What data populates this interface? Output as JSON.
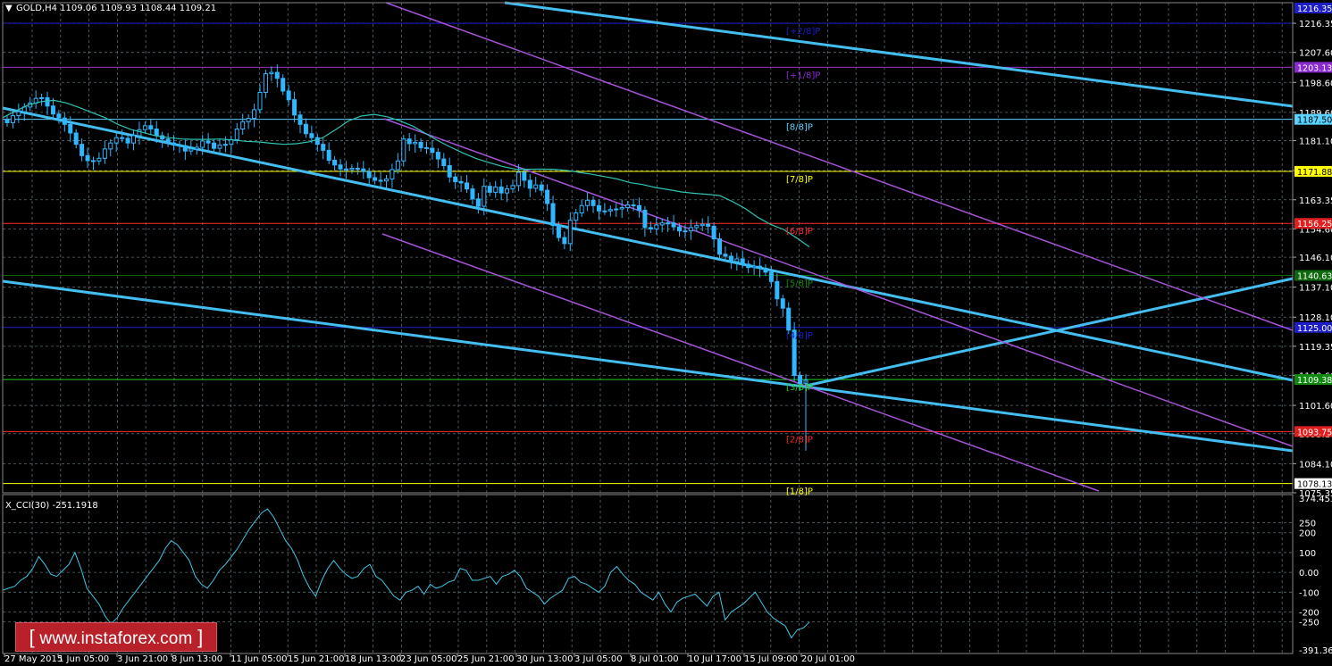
{
  "window": {
    "symbol_header": "GOLD,H4  1109.06 1109.93 1108.44 1109.21",
    "indicator_header": "X_CCI(30) -251.1918"
  },
  "colors": {
    "background": "#000000",
    "grid": "#5a6b72",
    "bull": "#2fb7ff",
    "bear": "#2fb7ff",
    "ma": "#2fc4b2",
    "channel_cyan": "#44bdf0",
    "channel_purple": "#a653d8",
    "cci_line": "#42c6e6",
    "text": "#ffffff"
  },
  "chart_data": [
    {
      "type": "candlestick",
      "symbol": "GOLD",
      "timeframe": "H4",
      "ylim": [
        1075.35,
        1222
      ],
      "x_tick_labels": [
        "27 May 2015",
        "1 Jun 05:00",
        "3 Jun 21:00",
        "8 Jun 13:00",
        "11 Jun 05:00",
        "15 Jun 21:00",
        "18 Jun 13:00",
        "23 Jun 05:00",
        "25 Jun 21:00",
        "30 Jun 13:00",
        "3 Jul 05:00",
        "8 Jul 01:00",
        "10 Jul 17:00",
        "15 Jul 09:00",
        "20 Jul 01:00"
      ],
      "y_tick_labels": [
        1216.35,
        1207.6,
        1198.6,
        1189.6,
        1181.1,
        1172.1,
        1163.35,
        1154.6,
        1146.1,
        1137.1,
        1128.1,
        1119.35,
        1110.6,
        1101.6,
        1093.1,
        1084.1,
        1075.35
      ],
      "close_series": [
        1186.5,
        1188.6,
        1189.8,
        1191.2,
        1192.4,
        1193.8,
        1194.0,
        1191.5,
        1189.1,
        1187.9,
        1186.0,
        1183.4,
        1180.0,
        1176.6,
        1175.1,
        1175.0,
        1175.8,
        1178.6,
        1180.4,
        1182.0,
        1181.8,
        1180.4,
        1182.6,
        1184.4,
        1185.6,
        1184.6,
        1182.6,
        1181.6,
        1180.4,
        1179.8,
        1179.6,
        1178.0,
        1178.6,
        1179.1,
        1181.0,
        1180.4,
        1178.8,
        1179.8,
        1180.0,
        1181.4,
        1184.6,
        1186.8,
        1187.8,
        1190.4,
        1195.6,
        1201.2,
        1201.6,
        1199.8,
        1196.0,
        1193.4,
        1188.8,
        1186.0,
        1183.2,
        1182.0,
        1180.0,
        1178.2,
        1175.2,
        1173.8,
        1172.6,
        1172.4,
        1172.8,
        1172.6,
        1171.8,
        1170.0,
        1169.2,
        1169.0,
        1169.6,
        1172.4,
        1175.0,
        1181.6,
        1180.2,
        1180.6,
        1179.0,
        1178.8,
        1177.6,
        1175.6,
        1173.6,
        1170.2,
        1168.8,
        1168.4,
        1166.6,
        1163.6,
        1161.4,
        1167.4,
        1165.6,
        1167.2,
        1165.4,
        1166.6,
        1167.6,
        1171.6,
        1169.2,
        1166.8,
        1167.8,
        1166.2,
        1162.2,
        1155.6,
        1152.0,
        1150.2,
        1157.2,
        1159.4,
        1161.6,
        1163.2,
        1161.6,
        1160.0,
        1160.0,
        1160.4,
        1160.6,
        1161.0,
        1161.8,
        1161.6,
        1160.2,
        1155.0,
        1154.6,
        1155.8,
        1156.4,
        1156.4,
        1155.2,
        1154.0,
        1154.0,
        1155.0,
        1155.6,
        1156.0,
        1155.4,
        1151.6,
        1147.0,
        1146.4,
        1144.8,
        1145.6,
        1144.0,
        1143.0,
        1143.4,
        1142.8,
        1141.6,
        1138.8,
        1133.6,
        1130.8,
        1124.2,
        1110.6,
        1108.2,
        1109.2
      ],
      "ma_series": [
        1188.0,
        1190.0,
        1191.8,
        1192.8,
        1193.2,
        1192.4,
        1191.0,
        1189.5,
        1188.0,
        1186.0,
        1184.5,
        1183.5,
        1182.5,
        1182.0,
        1181.6,
        1181.5,
        1181.5,
        1181.6,
        1181.3,
        1180.9,
        1180.7,
        1180.3,
        1180.0,
        1180.2,
        1180.8,
        1182.0,
        1184.4,
        1187.0,
        1188.5,
        1189.0,
        1188.3,
        1187.1,
        1185.5,
        1183.3,
        1181.1,
        1179.1,
        1177.3,
        1175.7,
        1174.5,
        1173.4,
        1172.6,
        1172.5,
        1172.6,
        1172.5,
        1172.2,
        1171.6,
        1171.0,
        1170.3,
        1169.6,
        1168.5,
        1167.9,
        1167.0,
        1166.4,
        1165.7,
        1165.3,
        1165.0,
        1164.6,
        1162.8,
        1160.7,
        1158.0,
        1155.9,
        1154.4,
        1151.9,
        1149.2
      ],
      "horizontal_levels": [
        {
          "price": 1216.35,
          "tag": "[+2/8]P",
          "line_color": "#1e1ec8",
          "label_color": "#1e1ec8",
          "box_color": "#1e1ec8"
        },
        {
          "price": 1203.13,
          "tag": "[+1/8]P",
          "line_color": "#9b2fc8",
          "label_color": "#8a2bd0",
          "box_color": "#8a2bd0",
          "price_label": "1203.13"
        },
        {
          "price": 1187.5,
          "tag": "[8/8]P",
          "line_color": "#5ad2ff",
          "label_color": "#5ad2ff",
          "box_color": "#5ad2ff",
          "price_label": "1187.50"
        },
        {
          "price": 1171.88,
          "tag": "[7/8]P",
          "line_color": "#ffff00",
          "label_color": "#ffff00",
          "box_color": "#ffff00",
          "price_label": "1171.88"
        },
        {
          "price": 1156.25,
          "tag": "[6/8]P",
          "line_color": "#ff2a2a",
          "label_color": "#ff2a2a",
          "box_color": "#e02020",
          "price_label": "1156.25"
        },
        {
          "price": 1140.63,
          "tag": "[5/8]P",
          "line_color": "#0a6a0a",
          "label_color": "#0f8a0f",
          "box_color": "#0f6a0f",
          "price_label": "1140.63"
        },
        {
          "price": 1125.0,
          "tag": "[4/8]P",
          "line_color": "#1e1ec8",
          "label_color": "#1e1ec8",
          "box_color": "#1e1ec8",
          "price_label": "1125.00"
        },
        {
          "price": 1109.38,
          "tag": "[3/8]P",
          "line_color": "#1fd01f",
          "label_color": "#1fd01f",
          "box_color": "#0f8a0f",
          "price_label": "1109.38"
        },
        {
          "price": 1093.75,
          "tag": "[2/8]P",
          "line_color": "#ff2a2a",
          "label_color": "#ff2a2a",
          "box_color": "#e02020",
          "price_label": "1093.75"
        },
        {
          "price": 1078.13,
          "tag": "[1/8]P",
          "line_color": "#ffff00",
          "label_color": "#ffff00",
          "box_color": "#ffffff",
          "price_label": "1078.13"
        }
      ],
      "current_price_label": "1216.35"
    },
    {
      "type": "line",
      "name": "X_CCI(30)",
      "ylim": [
        -391.369,
        374.4537
      ],
      "y_tick_labels": [
        "374.4537",
        "250",
        "200",
        "100",
        "0.00",
        "-100",
        "-200",
        "-250",
        "-391.369"
      ],
      "levels": [
        250,
        200,
        100,
        0,
        -100,
        -200,
        -250
      ],
      "values": [
        -90,
        -80,
        -70,
        -40,
        -20,
        20,
        80,
        40,
        -10,
        -20,
        10,
        40,
        100,
        20,
        -80,
        -120,
        -160,
        -220,
        -260,
        -230,
        -180,
        -140,
        -100,
        -60,
        -20,
        20,
        60,
        120,
        160,
        140,
        100,
        60,
        -20,
        -60,
        -80,
        -40,
        10,
        40,
        80,
        120,
        170,
        220,
        260,
        300,
        320,
        280,
        220,
        160,
        120,
        60,
        -20,
        -80,
        -120,
        -40,
        20,
        60,
        20,
        -10,
        -30,
        -20,
        20,
        40,
        -20,
        -40,
        -80,
        -120,
        -140,
        -100,
        -90,
        -70,
        -110,
        -60,
        -80,
        -70,
        -50,
        -40,
        20,
        10,
        -40,
        -40,
        -30,
        -20,
        -60,
        -20,
        -10,
        10,
        -20,
        -80,
        -100,
        -120,
        -160,
        -130,
        -110,
        -90,
        -30,
        -20,
        -50,
        -60,
        -80,
        -100,
        -70,
        0,
        30,
        -10,
        -40,
        -60,
        -100,
        -120,
        -140,
        -100,
        -160,
        -200,
        -150,
        -130,
        -120,
        -110,
        -140,
        -170,
        -120,
        -100,
        -240,
        -200,
        -180,
        -160,
        -130,
        -100,
        -150,
        -200,
        -230,
        -251,
        -270,
        -330,
        -290,
        -280,
        -251
      ]
    }
  ],
  "watermark": {
    "bracket_open": "[",
    "text": "www.instaforex",
    "dot": ".",
    "tld": "com",
    "bracket_close": "]"
  }
}
